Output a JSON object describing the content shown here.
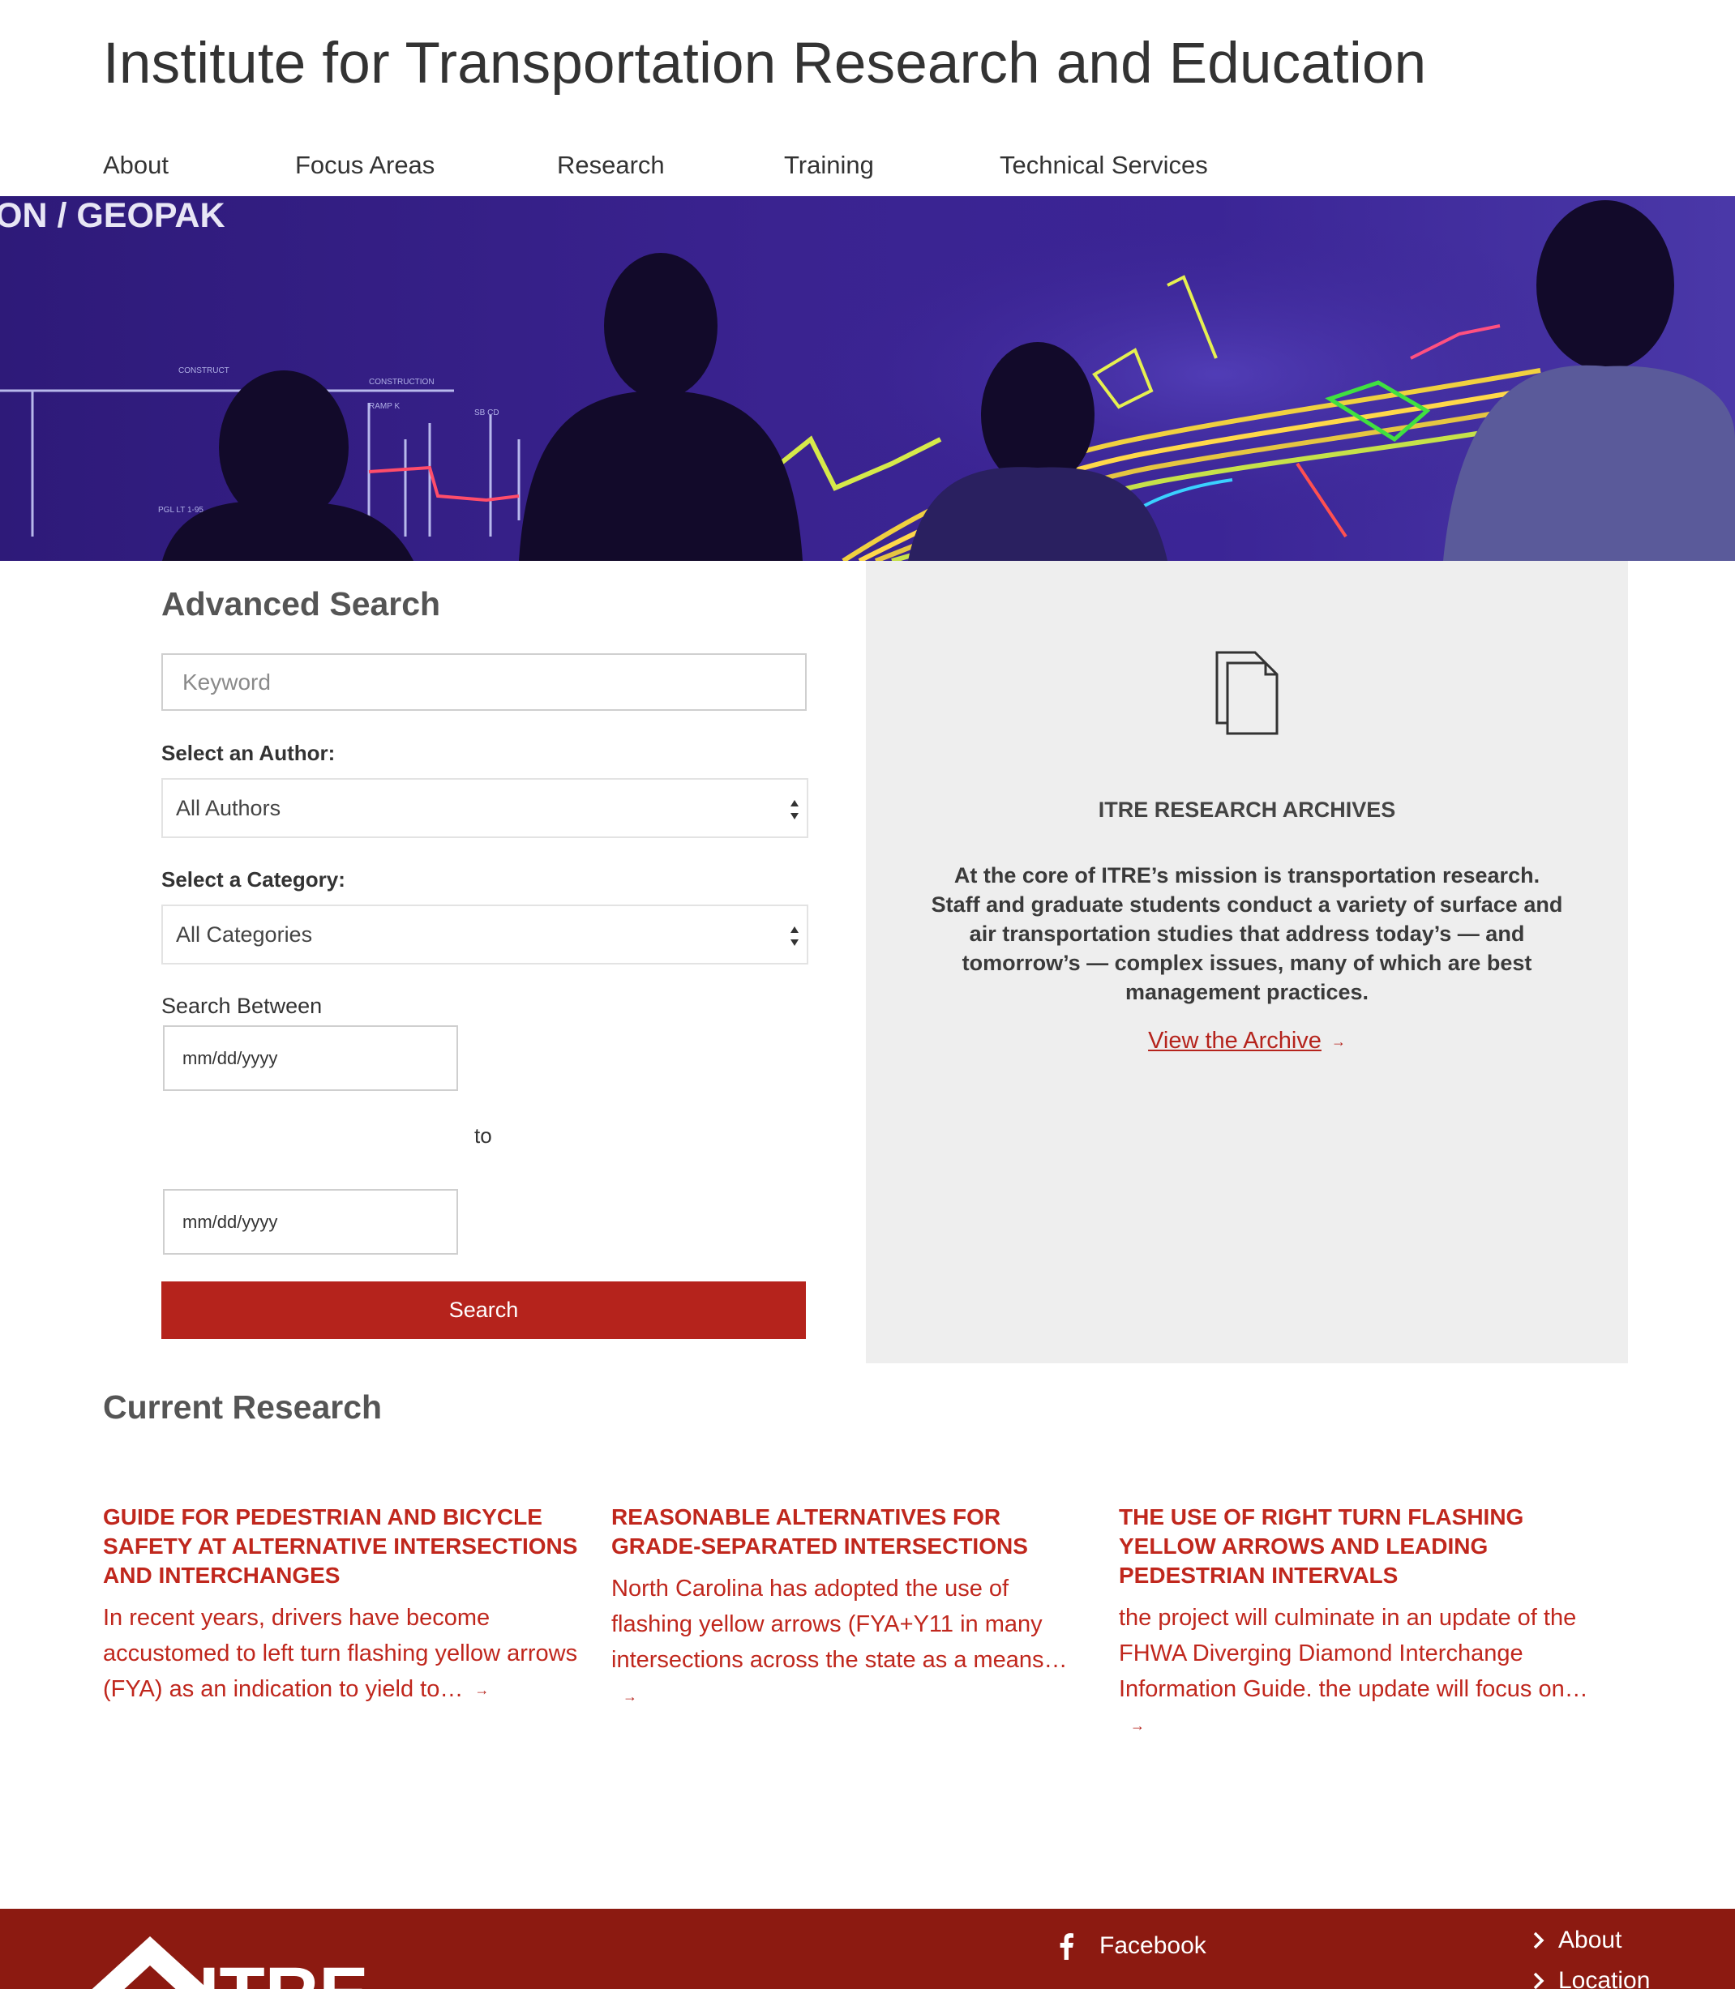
{
  "header": {
    "site_title": "Institute for Transportation Research and Education"
  },
  "nav": {
    "items": [
      {
        "label": "About"
      },
      {
        "label": "Focus Areas"
      },
      {
        "label": "Research"
      },
      {
        "label": "Training"
      },
      {
        "label": "Technical Services"
      }
    ]
  },
  "hero": {
    "screen_label": "ON / GEOPAK"
  },
  "search": {
    "heading": "Advanced Search",
    "keyword_placeholder": "Keyword",
    "author_label": "Select an Author:",
    "author_selected": "All Authors",
    "category_label": "Select a Category:",
    "category_selected": "All Categories",
    "between_label": "Search Between",
    "date_from_placeholder": "mm/dd/yyyy",
    "to_label": "to",
    "date_to_placeholder": "mm/dd/yyyy",
    "button_label": "Search"
  },
  "archive": {
    "icon": "documents-icon",
    "title": "ITRE RESEARCH ARCHIVES",
    "text": "At the core of ITRE’s mission is transportation research. Staff and graduate students conduct a variety of surface and air transportation studies that address today’s — and tomorrow’s — complex issues, many of which are best management practices.",
    "link_label": "View the Archive",
    "arrow": "→"
  },
  "current_research": {
    "heading": "Current Research",
    "items": [
      {
        "title": "Guide for Pedestrian and Bicycle Safety at Alternative Intersections and Interchanges",
        "excerpt": "In recent years, drivers have become accustomed to left turn flashing yellow arrows (FYA) as an indication to yield to…",
        "arrow": "→"
      },
      {
        "title": "Reasonable Alternatives for Grade-Separated Intersections",
        "excerpt": "North Carolina has adopted the use of flashing yellow arrows (FYA+Y11 in many intersections across the state as a means…",
        "arrow": "→"
      },
      {
        "title": "The Use of Right Turn Flashing Yellow Arrows and Leading Pedestrian Intervals",
        "excerpt": "the project will culminate in an update of the FHWA Diverging Diamond Interchange Information Guide. the update will focus on…",
        "arrow": "→"
      }
    ]
  },
  "footer": {
    "logo_text": "ITRE",
    "social": {
      "label": "Facebook",
      "icon": "facebook-icon"
    },
    "links": [
      {
        "label": "About",
        "icon": "chevron-right-icon"
      },
      {
        "label": "Location",
        "icon": "chevron-right-icon"
      }
    ],
    "background_color": "#8c1a11"
  },
  "colors": {
    "accent": "#b5231c",
    "research_text": "#c0271d",
    "panel_bg": "#eeeeee"
  }
}
